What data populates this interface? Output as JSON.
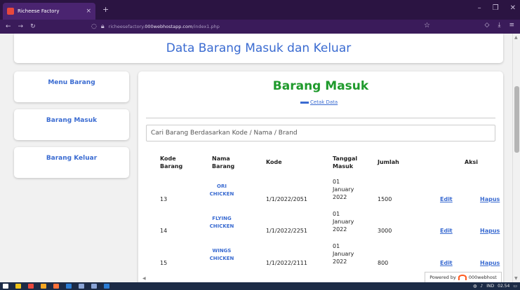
{
  "browser": {
    "tab_title": "Richeese Factory",
    "tab_close": "×",
    "new_tab": "+",
    "url_prefix": "richeesefactory.",
    "url_domain": "000webhostapp.com",
    "url_path": "/index1.php",
    "win_minimize": "–",
    "win_maximize": "❐",
    "win_close": "✕"
  },
  "page": {
    "header": "Data Barang Masuk dan Keluar",
    "sidebar": [
      "Menu Barang",
      "Barang Masuk",
      "Barang Keluar"
    ],
    "title": "Barang Masuk",
    "print_link": "Cetak Data",
    "search_placeholder": "Cari Barang Berdasarkan Kode / Nama / Brand",
    "columns": {
      "kode_barang": "Kode Barang",
      "nama_barang": "Nama Barang",
      "kode": "Kode",
      "tanggal": "Tanggal Masuk",
      "jumlah": "Jumlah",
      "aksi": "Aksi"
    },
    "rows": [
      {
        "kode_barang": "13",
        "nama_barang": "ORI CHICKEN",
        "kode": "1/1/2022/2051",
        "tanggal": "01 January 2022",
        "jumlah": "1500",
        "edit": "Edit",
        "hapus": "Hapus"
      },
      {
        "kode_barang": "14",
        "nama_barang": "FLYING CHICKEN",
        "kode": "1/1/2022/2251",
        "tanggal": "01 January 2022",
        "jumlah": "3000",
        "edit": "Edit",
        "hapus": "Hapus"
      },
      {
        "kode_barang": "15",
        "nama_barang": "WINGS CHICKEN",
        "kode": "1/1/2022/2111",
        "tanggal": "01 January 2022",
        "jumlah": "800",
        "edit": "Edit",
        "hapus": "Hapus"
      }
    ],
    "powered_by": "Powered by",
    "powered_brand": "000webhost"
  },
  "taskbar": {
    "lang": "IND",
    "time": "02.54"
  },
  "colors": {
    "accent": "#3a6bd1",
    "title_green": "#1f9a2c",
    "chrome": "#2b1442"
  }
}
